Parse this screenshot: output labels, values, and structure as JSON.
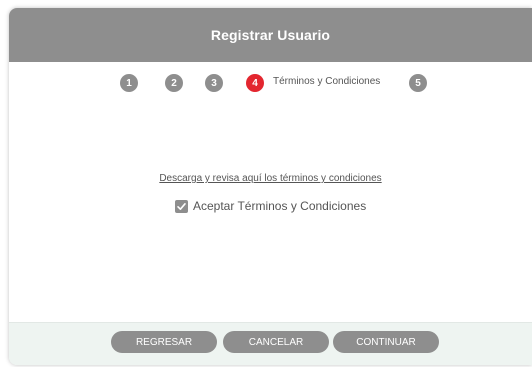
{
  "header": {
    "title": "Registrar Usuario"
  },
  "steps": {
    "items": [
      {
        "number": "1",
        "active": false
      },
      {
        "number": "2",
        "active": false
      },
      {
        "number": "3",
        "active": false
      },
      {
        "number": "4",
        "active": true
      },
      {
        "number": "5",
        "active": false
      }
    ],
    "active_label": "Términos y Condiciones"
  },
  "content": {
    "terms_link": "Descarga y revisa aquí los términos y condiciones",
    "accept_label": "Aceptar Términos y Condiciones",
    "accept_checked": true
  },
  "footer": {
    "back_label": "REGRESAR",
    "cancel_label": "CANCELAR",
    "continue_label": "CONTINUAR"
  },
  "colors": {
    "header_bg": "#8e8e8e",
    "active_step": "#e3262f",
    "footer_bg": "#eef4f1",
    "button_bg": "#8e8e8e"
  }
}
